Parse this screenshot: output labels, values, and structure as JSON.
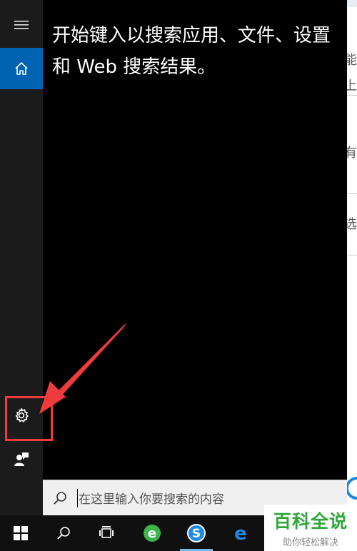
{
  "start_search": {
    "hint_text": "开始键入以搜索应用、文件、设置和 Web 搜索结果。",
    "search_placeholder": "在这里输入你要搜索的内容"
  },
  "rail": {
    "items": [
      {
        "icon": "hamburger-menu-icon"
      },
      {
        "icon": "home-icon",
        "active": true
      },
      {
        "icon": "gear-icon"
      },
      {
        "icon": "feedback-person-icon"
      }
    ]
  },
  "taskbar": {
    "items": [
      {
        "icon": "windows-start-icon"
      },
      {
        "icon": "search-icon"
      },
      {
        "icon": "task-view-icon"
      },
      {
        "icon": "ie-browser-icon"
      },
      {
        "icon": "sogou-browser-icon"
      },
      {
        "icon": "edge-browser-icon"
      }
    ]
  },
  "background_doc": {
    "fragments": [
      "能",
      "上",
      "有",
      "选"
    ]
  },
  "watermark": {
    "title": "百科全说",
    "subtitle": "助你轻松解决"
  },
  "colors": {
    "accent": "#0063b1",
    "panel_bg": "#000000",
    "rail_bg": "#1b1b1b",
    "annotation_red": "#ee3b3b",
    "watermark_green": "#2da83a"
  }
}
